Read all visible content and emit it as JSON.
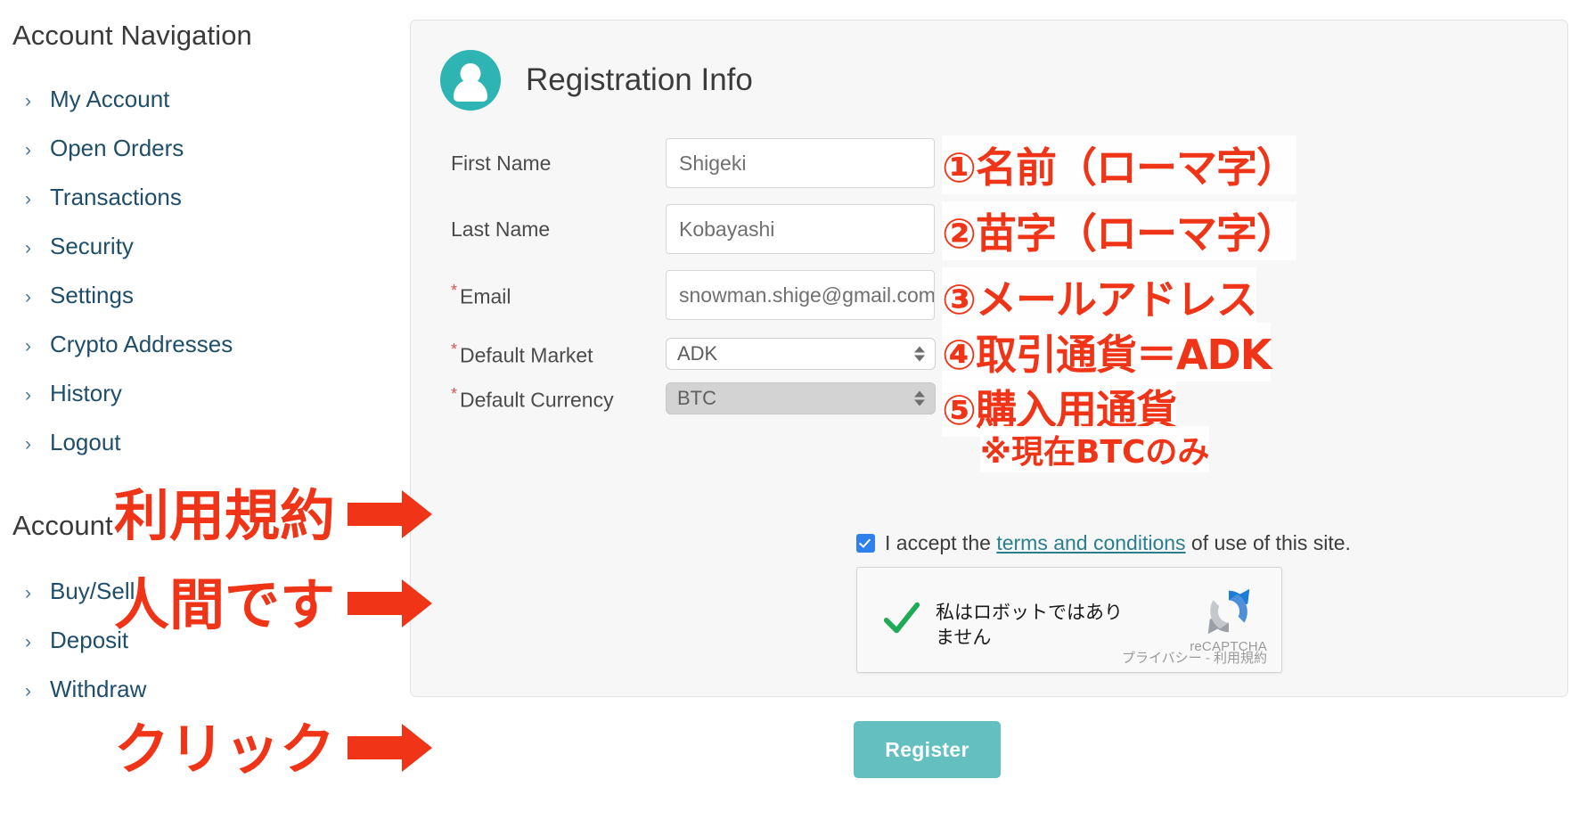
{
  "sidebar": {
    "section1_title": "Account Navigation",
    "section1_items": [
      {
        "label": "My Account"
      },
      {
        "label": "Open Orders"
      },
      {
        "label": "Transactions"
      },
      {
        "label": "Security"
      },
      {
        "label": "Settings"
      },
      {
        "label": "Crypto Addresses"
      },
      {
        "label": "History"
      },
      {
        "label": "Logout"
      }
    ],
    "section2_title": "Account",
    "section2_items": [
      {
        "label": "Buy/Sell"
      },
      {
        "label": "Deposit"
      },
      {
        "label": "Withdraw"
      }
    ],
    "chevron": "›"
  },
  "panel": {
    "title": "Registration Info",
    "avatar_icon": "user-avatar-icon",
    "fields": [
      {
        "label": "First Name",
        "required": false,
        "value": "Shigeki",
        "type": "text"
      },
      {
        "label": "Last Name",
        "required": false,
        "value": "Kobayashi",
        "type": "text"
      },
      {
        "label": "Email",
        "required": true,
        "value": "snowman.shige@gmail.com",
        "type": "text"
      },
      {
        "label": "Default Market",
        "required": true,
        "value": "ADK",
        "type": "select",
        "disabled": false
      },
      {
        "label": "Default Currency",
        "required": true,
        "value": "BTC",
        "type": "select",
        "disabled": true
      }
    ],
    "required_marker": "*",
    "terms": {
      "checked": true,
      "before": "I accept the ",
      "link": "terms and conditions",
      "after": " of use of this site."
    },
    "recaptcha": {
      "label": "私はロボットではありません",
      "verified": true,
      "brand": "reCAPTCHA",
      "footer": "プライバシー - 利用規約"
    },
    "register_label": "Register"
  },
  "annotations": {
    "numbered": [
      {
        "num": "①",
        "text": "名前（ローマ字）"
      },
      {
        "num": "②",
        "text": "苗字（ローマ字）"
      },
      {
        "num": "③",
        "text": "メールアドレス"
      },
      {
        "num": "④",
        "text": "取引通貨＝ADK"
      },
      {
        "num": "⑤",
        "text": "購入用通貨"
      }
    ],
    "note": "※現在BTCのみ",
    "left_labels": [
      {
        "text": "利用規約"
      },
      {
        "text": "人間です"
      },
      {
        "text": "クリック"
      }
    ]
  },
  "colors": {
    "accent_teal": "#2fb4b4",
    "button_teal": "#63bfc0",
    "annotation_red": "#f03418",
    "link_teal": "#2a7f8e",
    "nav_blue": "#1f4e6b",
    "required_red": "#d9534f",
    "checkbox_blue": "#2f80ed"
  }
}
